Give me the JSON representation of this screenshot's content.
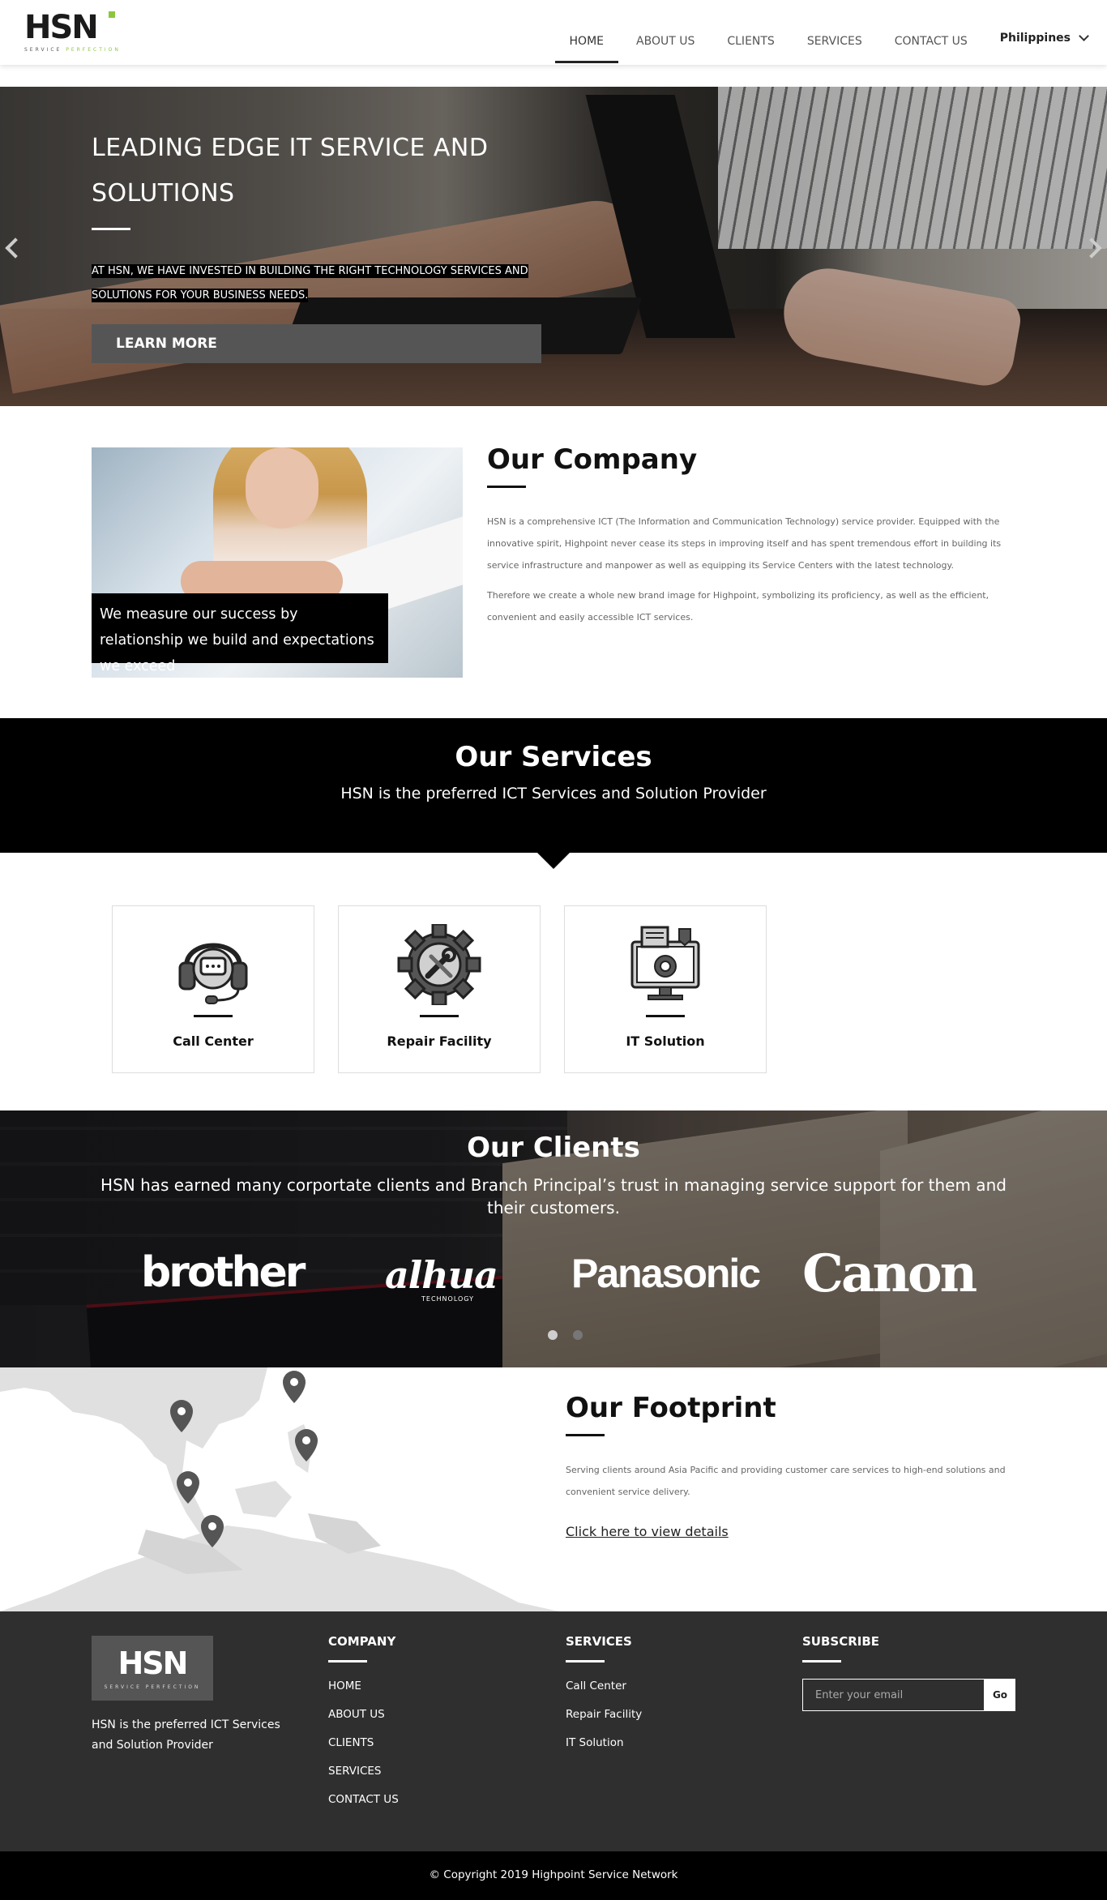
{
  "brand": {
    "logo_text": "HSN",
    "tagline_a": "SERVICE ",
    "tagline_b": "PERFECTION",
    "accent": "#8cc63f"
  },
  "nav": {
    "items": [
      "HOME",
      "ABOUT US",
      "CLIENTS",
      "SERVICES",
      "CONTACT US"
    ],
    "active": "HOME",
    "country": "Philippines"
  },
  "hero": {
    "title_line1": "LEADING EDGE IT SERVICE AND",
    "title_line2": "SOLUTIONS",
    "desc_line1": "AT HSN, WE HAVE INVESTED IN BUILDING THE RIGHT TECHNOLOGY SERVICES AND",
    "desc_line2": "SOLUTIONS FOR YOUR BUSINESS NEEDS.",
    "button": "LEARN MORE"
  },
  "company": {
    "caption": "We measure our success by relationship we build and expectations we exceed",
    "title": "Our Company",
    "para1": "HSN is a comprehensive ICT (The Information and Communication Technology) service provider. Equipped with the innovative spirit, Highpoint never cease its steps in improving itself and has spent tremendous effort in building its service infrastructure and manpower as well as equipping its Service Centers with the latest technology.",
    "para2": "Therefore we create a whole new brand image for Highpoint, symbolizing its proficiency, as well as the efficient, convenient and easily accessible ICT services."
  },
  "services": {
    "title": "Our Services",
    "subtitle": "HSN is the preferred ICT Services and Solution Provider",
    "cards": [
      {
        "label": "Call Center",
        "icon": "headset-icon"
      },
      {
        "label": "Repair Facility",
        "icon": "gear-wrench-icon"
      },
      {
        "label": "IT Solution",
        "icon": "computer-gear-icon"
      }
    ]
  },
  "clients": {
    "title": "Our Clients",
    "subtitle": "HSN has earned many corportate clients and Branch Principal’s trust in managing service support for them and their customers.",
    "logos": [
      "brother",
      "alhua",
      "TECHNOLOGY",
      "Panasonic",
      "Canon"
    ]
  },
  "footprint": {
    "title": "Our Footprint",
    "text": "Serving clients around Asia Pacific and providing customer care services to high-end solutions and convenient service delivery.",
    "link": "Click here to view details"
  },
  "footer": {
    "about": "HSN is the preferred ICT Services and Solution Provider",
    "company_head": "COMPANY",
    "company_links": [
      "HOME",
      "ABOUT US",
      "CLIENTS",
      "SERVICES",
      "CONTACT US"
    ],
    "services_head": "SERVICES",
    "services_links": [
      "Call Center",
      "Repair Facility",
      "IT Solution"
    ],
    "subscribe_head": "SUBSCRIBE",
    "email_placeholder": "Enter your email",
    "go": "Go",
    "copyright": "© Copyright 2019 Highpoint Service Network"
  }
}
